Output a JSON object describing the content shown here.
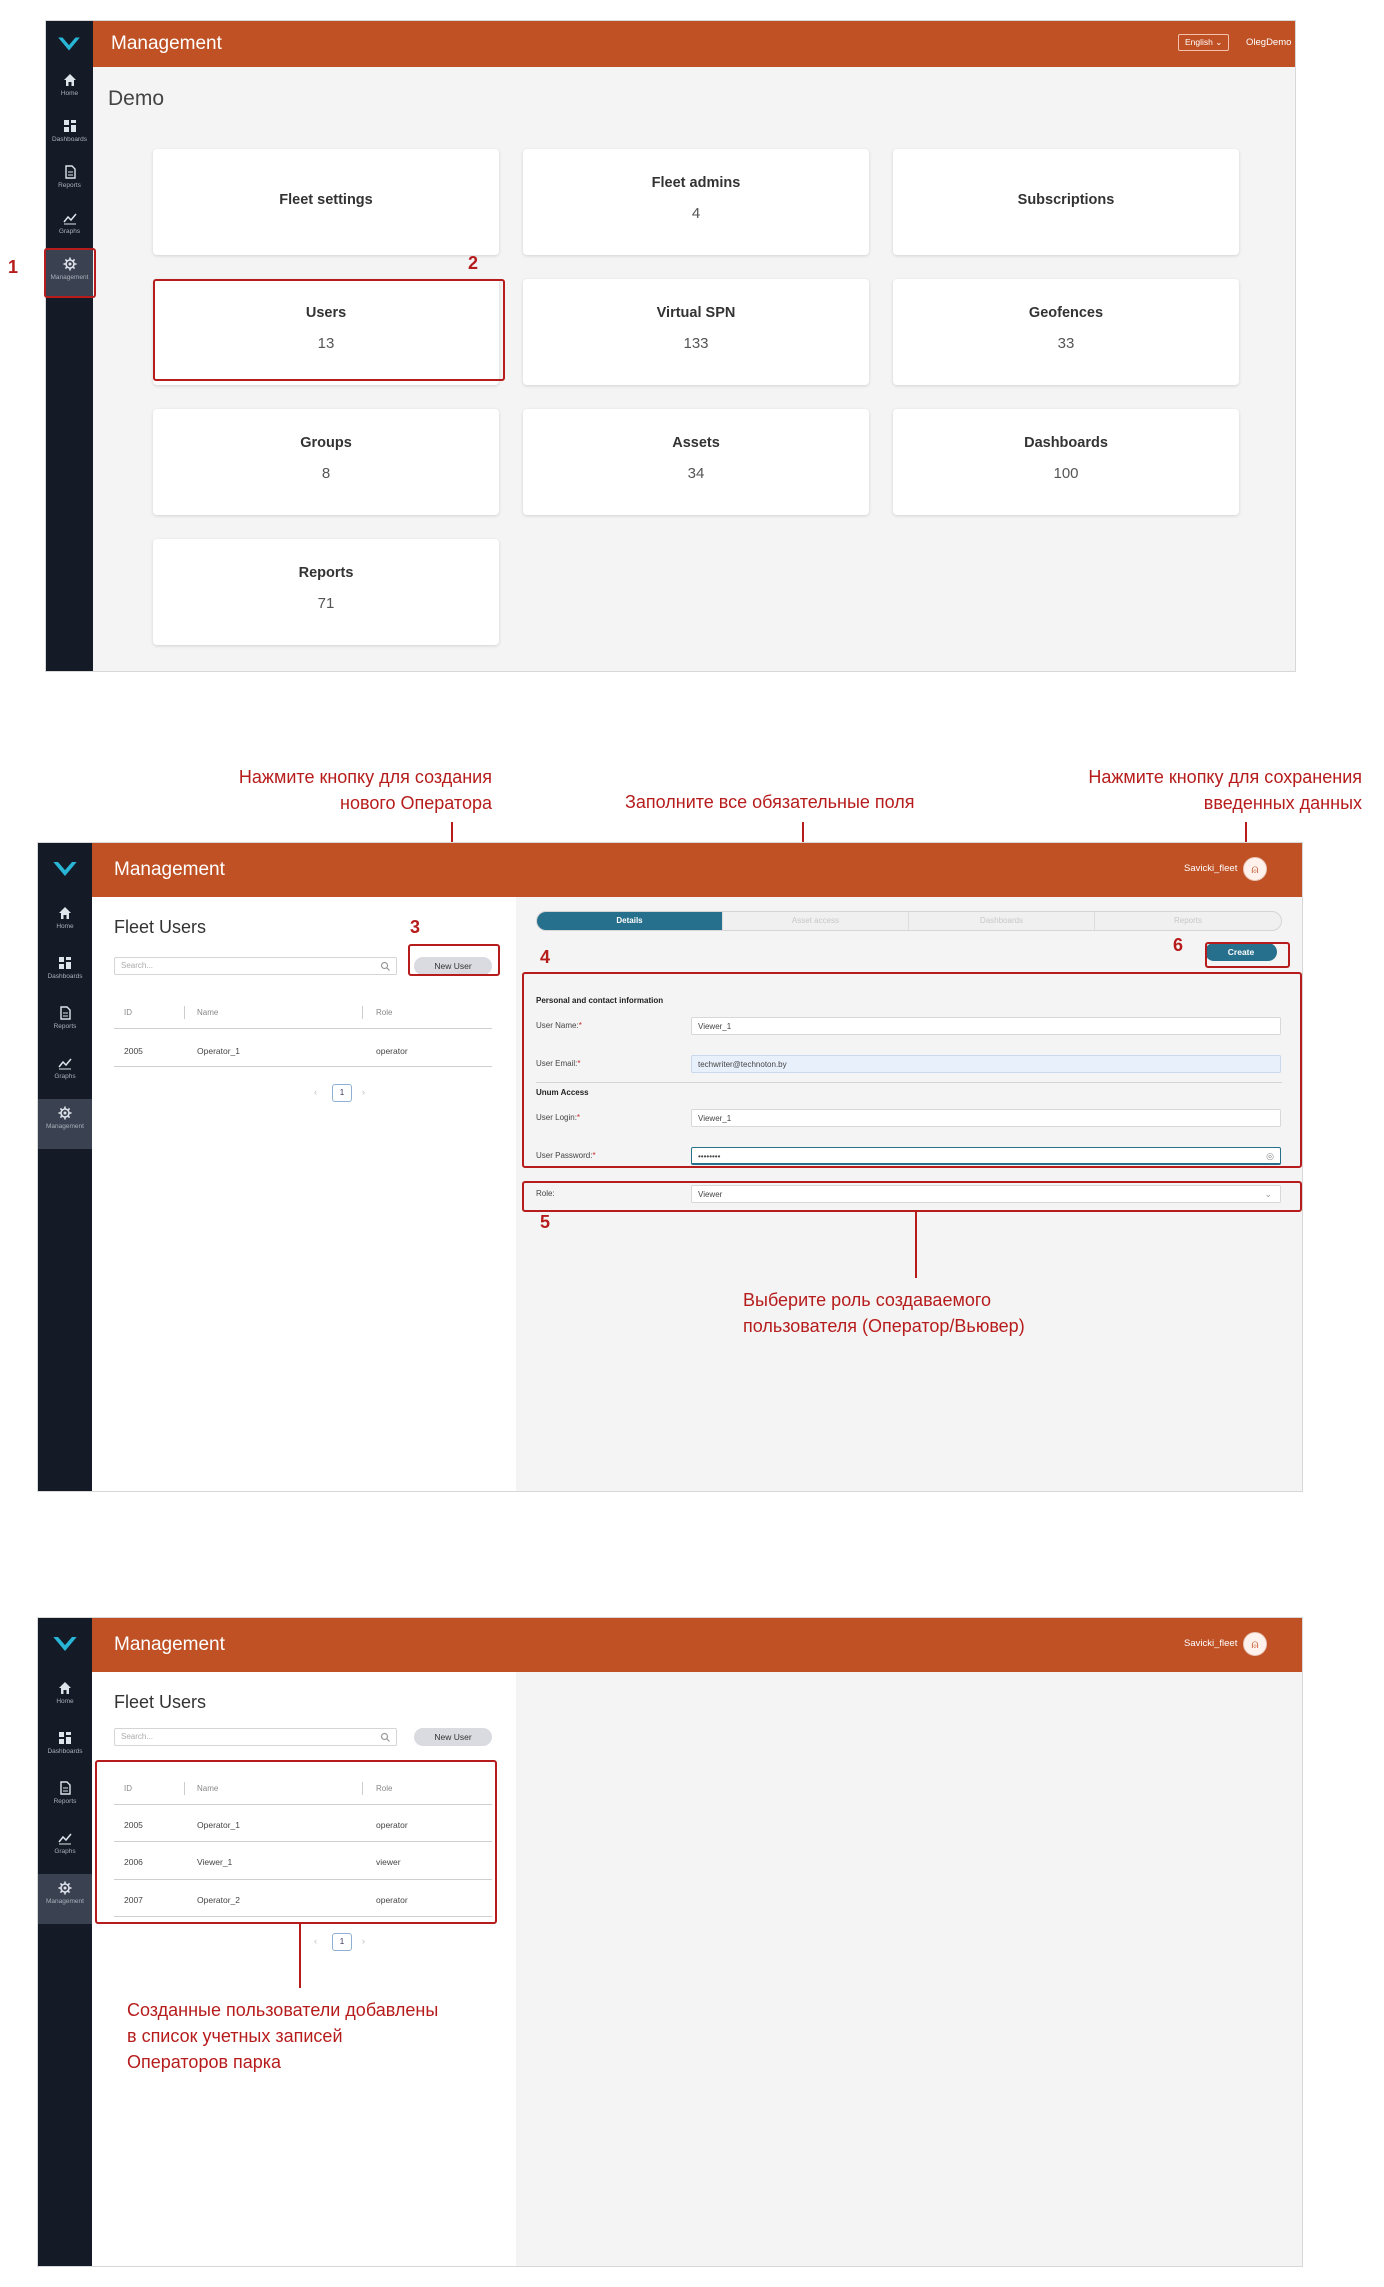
{
  "nav": {
    "home": "Home",
    "dashboards": "Dashboards",
    "reports": "Reports",
    "graphs": "Graphs",
    "management": "Management"
  },
  "screen1": {
    "title": "Management",
    "language": "English",
    "user": "OlegDemo",
    "page_title": "Demo",
    "cards": [
      {
        "title": "Fleet settings",
        "value": ""
      },
      {
        "title": "Fleet admins",
        "value": "4"
      },
      {
        "title": "Subscriptions",
        "value": ""
      },
      {
        "title": "Users",
        "value": "13"
      },
      {
        "title": "Virtual SPN",
        "value": "133"
      },
      {
        "title": "Geofences",
        "value": "33"
      },
      {
        "title": "Groups",
        "value": "8"
      },
      {
        "title": "Assets",
        "value": "34"
      },
      {
        "title": "Dashboards",
        "value": "100"
      },
      {
        "title": "Reports",
        "value": "71"
      }
    ],
    "markers": {
      "m1": "1",
      "m2": "2"
    }
  },
  "screen2": {
    "title": "Management",
    "user": "Savicki_fleet",
    "panel_title": "Fleet Users",
    "search_placeholder": "Search...",
    "new_user": "New User",
    "columns": {
      "id": "ID",
      "name": "Name",
      "role": "Role"
    },
    "rows": [
      {
        "id": "2005",
        "name": "Operator_1",
        "role": "operator"
      }
    ],
    "page": "1",
    "tabs": [
      "Details",
      "Asset access",
      "Dashboards",
      "Reports"
    ],
    "create": "Create",
    "section_personal": "Personal and contact information",
    "section_access": "Unum Access",
    "fields": {
      "user_name_label": "User Name:",
      "user_name": "Viewer_1",
      "user_email_label": "User Email:",
      "user_email": "techwriter@technoton.by",
      "user_login_label": "User Login:",
      "user_login": "Viewer_1",
      "user_password_label": "User Password:",
      "user_password": "••••••••",
      "role_label": "Role:",
      "role": "Viewer"
    },
    "required_mark": "*",
    "annotations": {
      "new_operator": "Нажмите кнопку для создания\nнового Оператора",
      "fill_fields": "Заполните все обязательные поля",
      "save": "Нажмите кнопку для сохранения\nвведенных данных",
      "role": "Выберите роль создаваемого\nпользователя (Оператор/Вьювер)"
    },
    "markers": {
      "m3": "3",
      "m4": "4",
      "m5": "5",
      "m6": "6"
    }
  },
  "screen3": {
    "title": "Management",
    "user": "Savicki_fleet",
    "panel_title": "Fleet Users",
    "search_placeholder": "Search...",
    "new_user": "New User",
    "columns": {
      "id": "ID",
      "name": "Name",
      "role": "Role"
    },
    "rows": [
      {
        "id": "2005",
        "name": "Operator_1",
        "role": "operator"
      },
      {
        "id": "2006",
        "name": "Viewer_1",
        "role": "viewer"
      },
      {
        "id": "2007",
        "name": "Operator_2",
        "role": "operator"
      }
    ],
    "page": "1",
    "annotation": "Созданные пользователи добавлены\nв список учетных записей\nОператоров парка"
  },
  "colors": {
    "brand": "#bf5125",
    "sidebar": "#141b27",
    "accent": "#26708e",
    "annotation": "#b71c1c"
  }
}
